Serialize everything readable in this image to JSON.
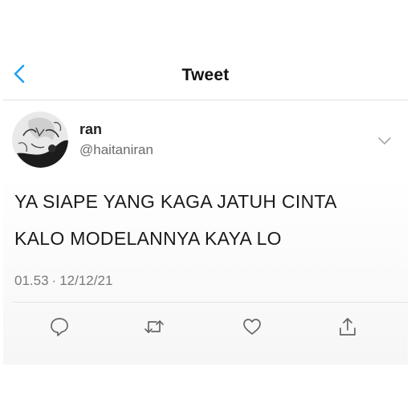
{
  "header": {
    "title": "Tweet",
    "back_icon": "chevron-left-icon"
  },
  "colors": {
    "accent": "#1da1f2",
    "text": "#111111",
    "muted": "#6b6b6b"
  },
  "tweet": {
    "author_name": "ran",
    "author_handle": "@haitaniran",
    "text_line_1": "YA SIAPE YANG KAGA JATUH CINTA",
    "text_line_2": "KALO MODELANNYA KAYA LO",
    "time": "01.53",
    "separator": "·",
    "date": "12/12/21"
  },
  "actions": [
    {
      "name": "reply",
      "icon": "reply-icon"
    },
    {
      "name": "retweet",
      "icon": "retweet-icon"
    },
    {
      "name": "like",
      "icon": "heart-icon"
    },
    {
      "name": "share",
      "icon": "share-icon"
    }
  ]
}
